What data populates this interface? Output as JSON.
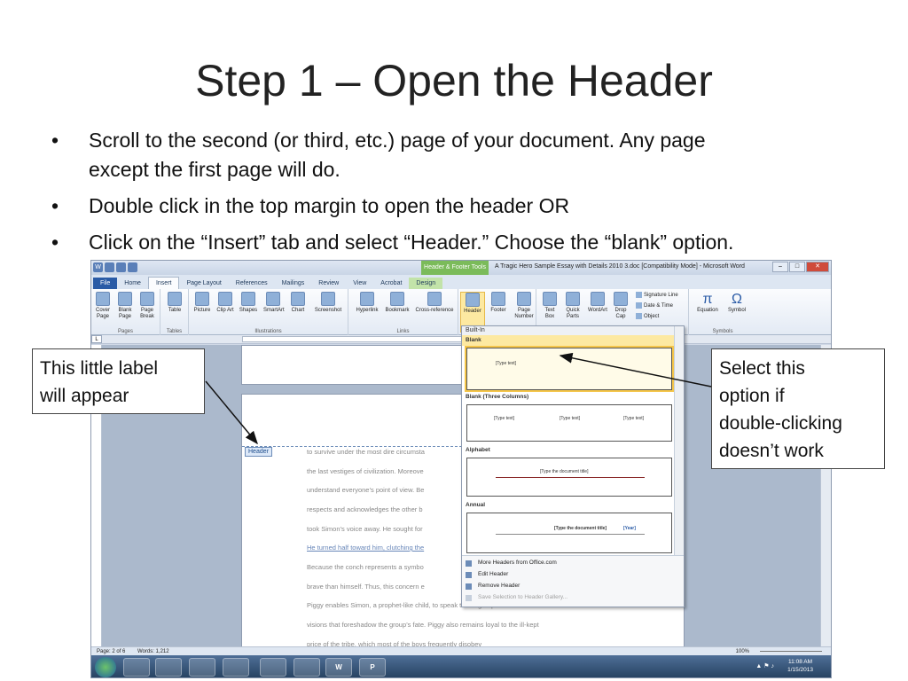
{
  "slide": {
    "title": "Step 1 – Open the Header",
    "bullet_char": "•",
    "bullets": [
      {
        "line1": "Scroll to the second (or third, etc.) page of your document.  Any page",
        "line2": "except the first page will do."
      },
      {
        "line1": "Double click in the top margin to open the header OR"
      },
      {
        "line1": "Click on the “Insert” tab and select “Header.”  Choose the “blank” option."
      }
    ]
  },
  "callouts": {
    "left": {
      "line1": "This little label",
      "line2": "will appear"
    },
    "right": {
      "line1": "Select this",
      "line2": "option if",
      "line3": "double-clicking",
      "line4": "doesn’t work"
    }
  },
  "word": {
    "qat": {
      "icon": "W"
    },
    "context_tab": "Header & Footer Tools",
    "window_title": "A Tragic Hero Sample Essay with Details 2010 3.doc [Compatibility Mode] - Microsoft Word",
    "tabs": [
      "File",
      "Home",
      "Insert",
      "Page Layout",
      "References",
      "Mailings",
      "Review",
      "View",
      "Acrobat",
      "Design"
    ],
    "ribbon": {
      "pages": {
        "name": "Pages",
        "cover": "Cover Page",
        "blank": "Blank Page",
        "break": "Page Break"
      },
      "tables": {
        "name": "Tables",
        "table": "Table"
      },
      "illustrations": {
        "name": "Illustrations",
        "picture": "Picture",
        "clipart": "Clip Art",
        "shapes": "Shapes",
        "smartart": "SmartArt",
        "chart": "Chart",
        "screenshot": "Screenshot"
      },
      "links": {
        "name": "Links",
        "hyperlink": "Hyperlink",
        "bookmark": "Bookmark",
        "crossref": "Cross-reference"
      },
      "hf": {
        "header": "Header",
        "footer": "Footer",
        "pagenum": "Page Number"
      },
      "text": {
        "textbox": "Text Box",
        "quickparts": "Quick Parts",
        "wordart": "WordArt",
        "dropcap": "Drop Cap",
        "sigline": "Signature Line",
        "datetime": "Date & Time",
        "object": "Object"
      },
      "symbols": {
        "name": "Symbols",
        "equation": "Equation",
        "symbol": "Symbol"
      }
    },
    "header_label": "Header",
    "doc_lines": [
      {
        "text": "to survive under the most dire circumsta",
        "link": false
      },
      {
        "text": "the last vestiges of civilization.  Moreove",
        "link": false
      },
      {
        "text": "understand everyone’s point of view.  Be",
        "link": false
      },
      {
        "text": "respects and acknowledges the other b",
        "link": false
      },
      {
        "text": "took Simon’s voice away.  He sought for",
        "link": false
      },
      {
        "text": "He turned half toward him, clutching the",
        "link": true
      },
      {
        "text": "Because the conch represents a symbo",
        "link": false
      },
      {
        "text": "brave than himself.  Thus, this concern e",
        "link": false
      },
      {
        "text": "Piggy enables Simon, a prophet-like child, to speak to the group and share his",
        "link": false
      },
      {
        "text": "visions that foreshadow the group’s fate.  Piggy also remains loyal to the ill-kept",
        "link": false
      },
      {
        "text": "price of the tribe, which most of the boys frequently disobey",
        "link": false
      }
    ],
    "gallery": {
      "section_builtin": "Built-In",
      "item_blank": "Blank",
      "item_three": "Blank (Three Columns)",
      "item_alphabet": "Alphabet",
      "item_annual": "Annual",
      "type_text": "[Type text]",
      "doc_title": "[Type the document title]",
      "year": "[Year]",
      "menu": [
        "More Headers from Office.com",
        "Edit Header",
        "Remove Header",
        "Save Selection to Header Gallery..."
      ]
    },
    "status": {
      "page": "Page: 2 of 6",
      "words": "Words: 1,212",
      "zoom": "100%"
    },
    "taskbar": {
      "word_label": "W",
      "ppt_label": "P",
      "time": "11:08 AM",
      "date": "1/15/2013"
    }
  }
}
